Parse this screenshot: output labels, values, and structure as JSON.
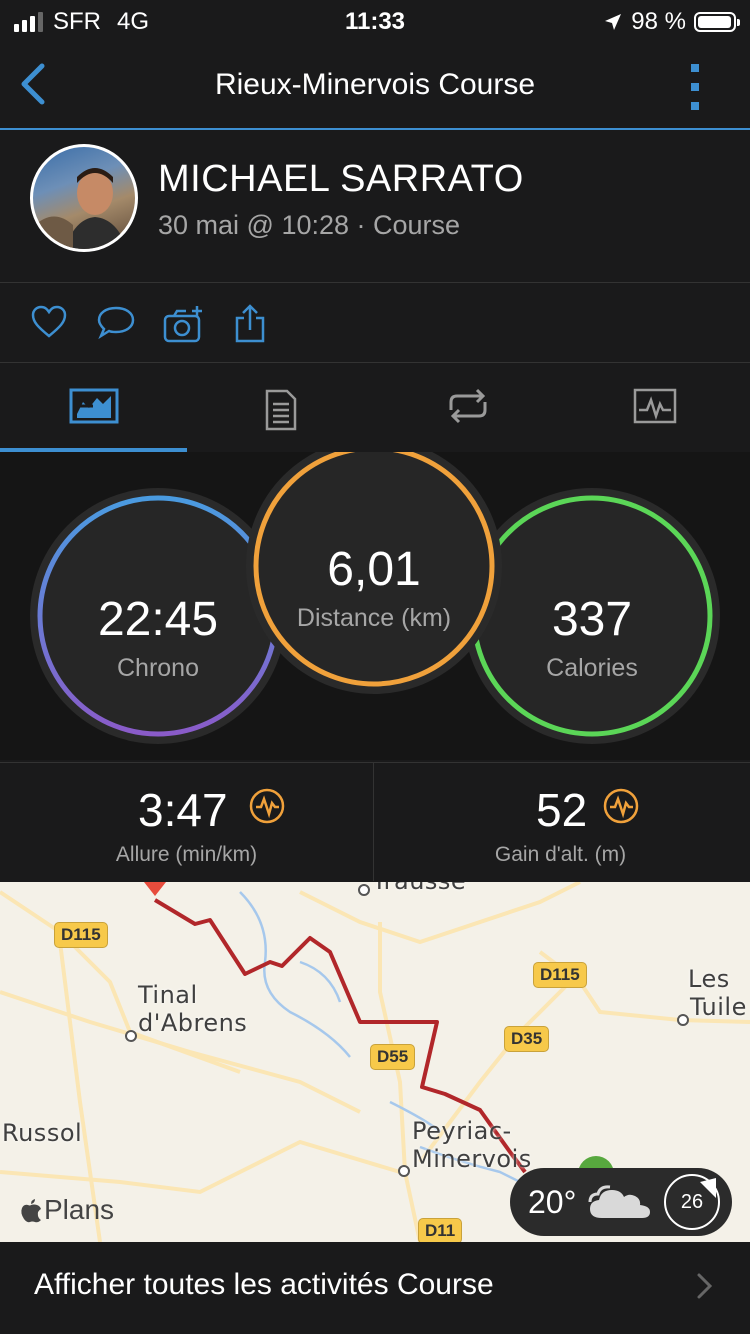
{
  "status_bar": {
    "carrier": "SFR",
    "network": "4G",
    "time": "11:33",
    "battery": "98 %"
  },
  "nav": {
    "title": "Rieux-Minervois Course",
    "back_icon": "chevron-left-icon",
    "more_icon": "more-vertical-icon"
  },
  "profile": {
    "name": "MICHAEL SARRATO",
    "date_line": "30 mai @ 10:28 · Course"
  },
  "actions": [
    "heart-icon",
    "comment-icon",
    "add-photo-icon",
    "share-icon"
  ],
  "tabs": [
    {
      "name": "tab-overview",
      "icon": "overview-icon",
      "active": true
    },
    {
      "name": "tab-stats",
      "icon": "stats-list-icon",
      "active": false
    },
    {
      "name": "tab-laps",
      "icon": "laps-icon",
      "active": false
    },
    {
      "name": "tab-charts",
      "icon": "charts-icon",
      "active": false
    }
  ],
  "summary": {
    "chrono": {
      "value": "22:45",
      "label": "Chrono"
    },
    "distance": {
      "value": "6,01",
      "label": "Distance (km)"
    },
    "calories": {
      "value": "337",
      "label": "Calories"
    }
  },
  "stats": {
    "pace": {
      "value": "3:47",
      "label": "Allure (min/km)"
    },
    "elevation": {
      "value": "52",
      "label": "Gain d'alt. (m)"
    }
  },
  "map": {
    "places": [
      "Tinal",
      "d'Abrens",
      "Les",
      "Tuile",
      "Russol",
      "Peyriac-",
      "Minervois",
      "Trausse"
    ],
    "roads": [
      "D115",
      "D115",
      "D35",
      "D55",
      "D11"
    ],
    "attribution": "Plans",
    "weather": {
      "temperature": "20°",
      "wind_speed": "26",
      "icon": "cloud-icon"
    }
  },
  "footer": {
    "label": "Afficher toutes les activités Course"
  },
  "colors": {
    "accent": "#3d8fd1",
    "distance_ring": "#f0a13b",
    "calories_ring": "#5bd657",
    "route": "#b1272a"
  }
}
